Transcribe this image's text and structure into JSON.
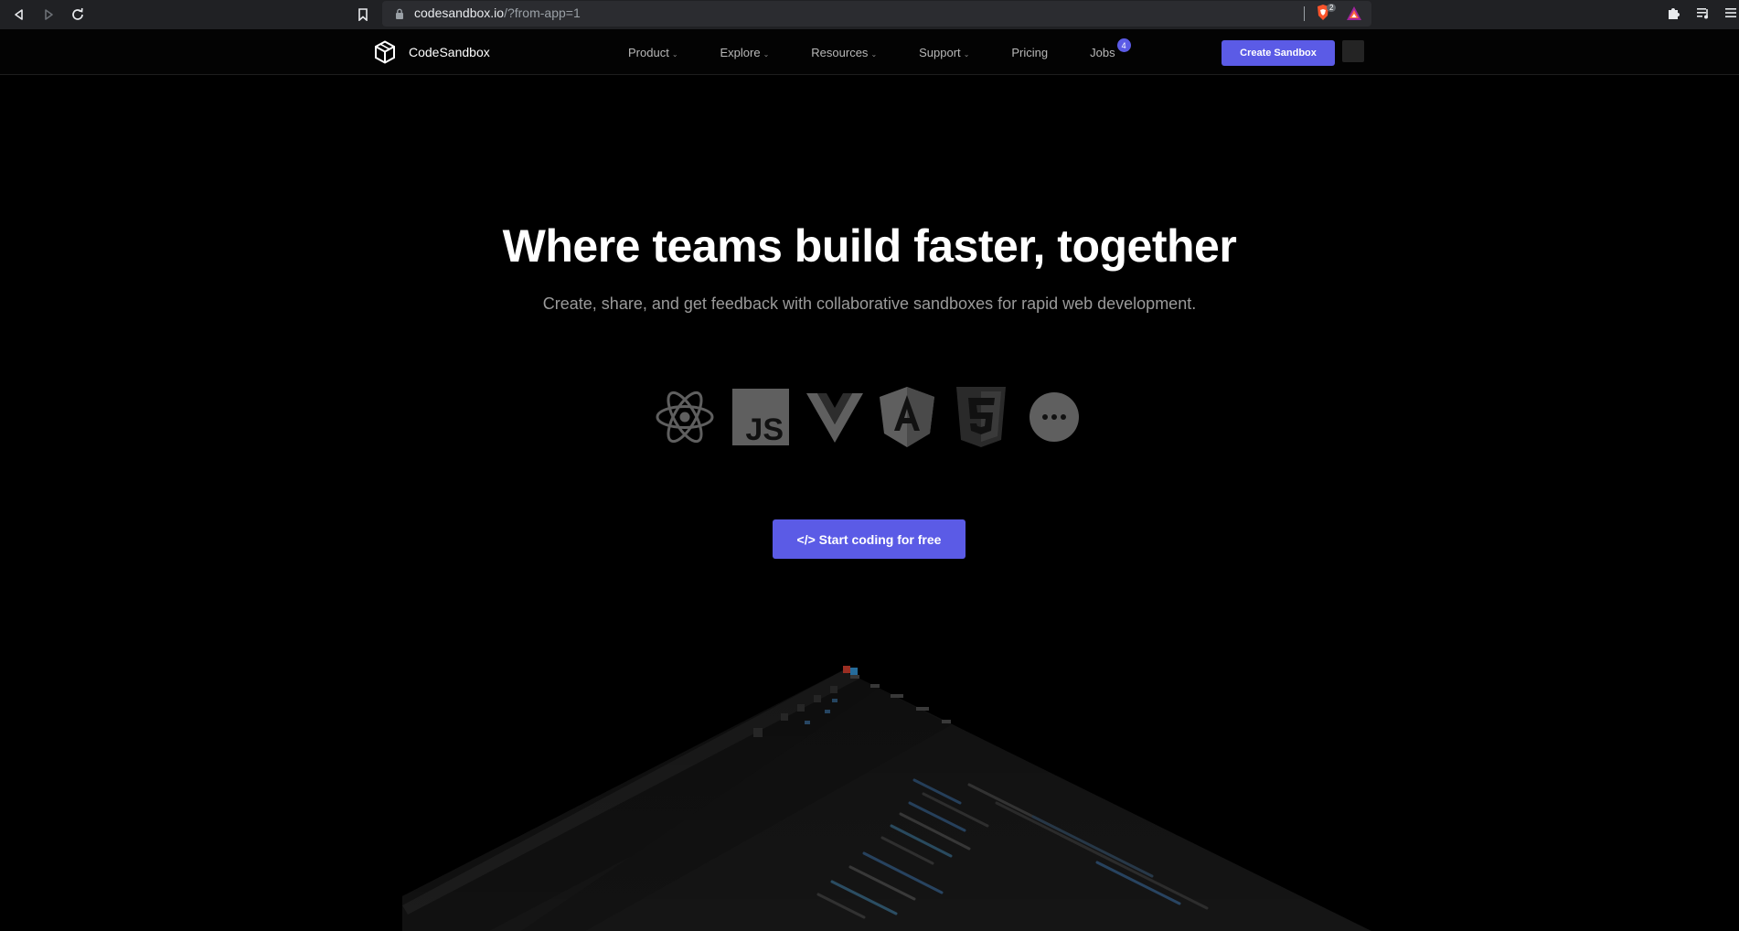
{
  "browser": {
    "url_host": "codesandbox.io",
    "url_path": "/?from-app=1",
    "shields_count": "2"
  },
  "header": {
    "brand": "CodeSandbox",
    "nav": [
      {
        "label": "Product",
        "has_menu": true
      },
      {
        "label": "Explore",
        "has_menu": true
      },
      {
        "label": "Resources",
        "has_menu": true
      },
      {
        "label": "Support",
        "has_menu": true
      },
      {
        "label": "Pricing",
        "has_menu": false
      },
      {
        "label": "Jobs",
        "has_menu": false,
        "badge": "4"
      }
    ],
    "create_button": "Create Sandbox"
  },
  "hero": {
    "title": "Where teams build faster, together",
    "subtitle": "Create, share, and get feedback with collaborative sandboxes for rapid web development.",
    "frameworks": [
      "react-icon",
      "javascript-icon",
      "vue-icon",
      "angular-icon",
      "html5-icon",
      "more-icon"
    ],
    "cta": "</> Start coding for free"
  },
  "colors": {
    "accent": "#5b5be6",
    "background": "#000000",
    "icon_gray": "#5f5f5f"
  }
}
